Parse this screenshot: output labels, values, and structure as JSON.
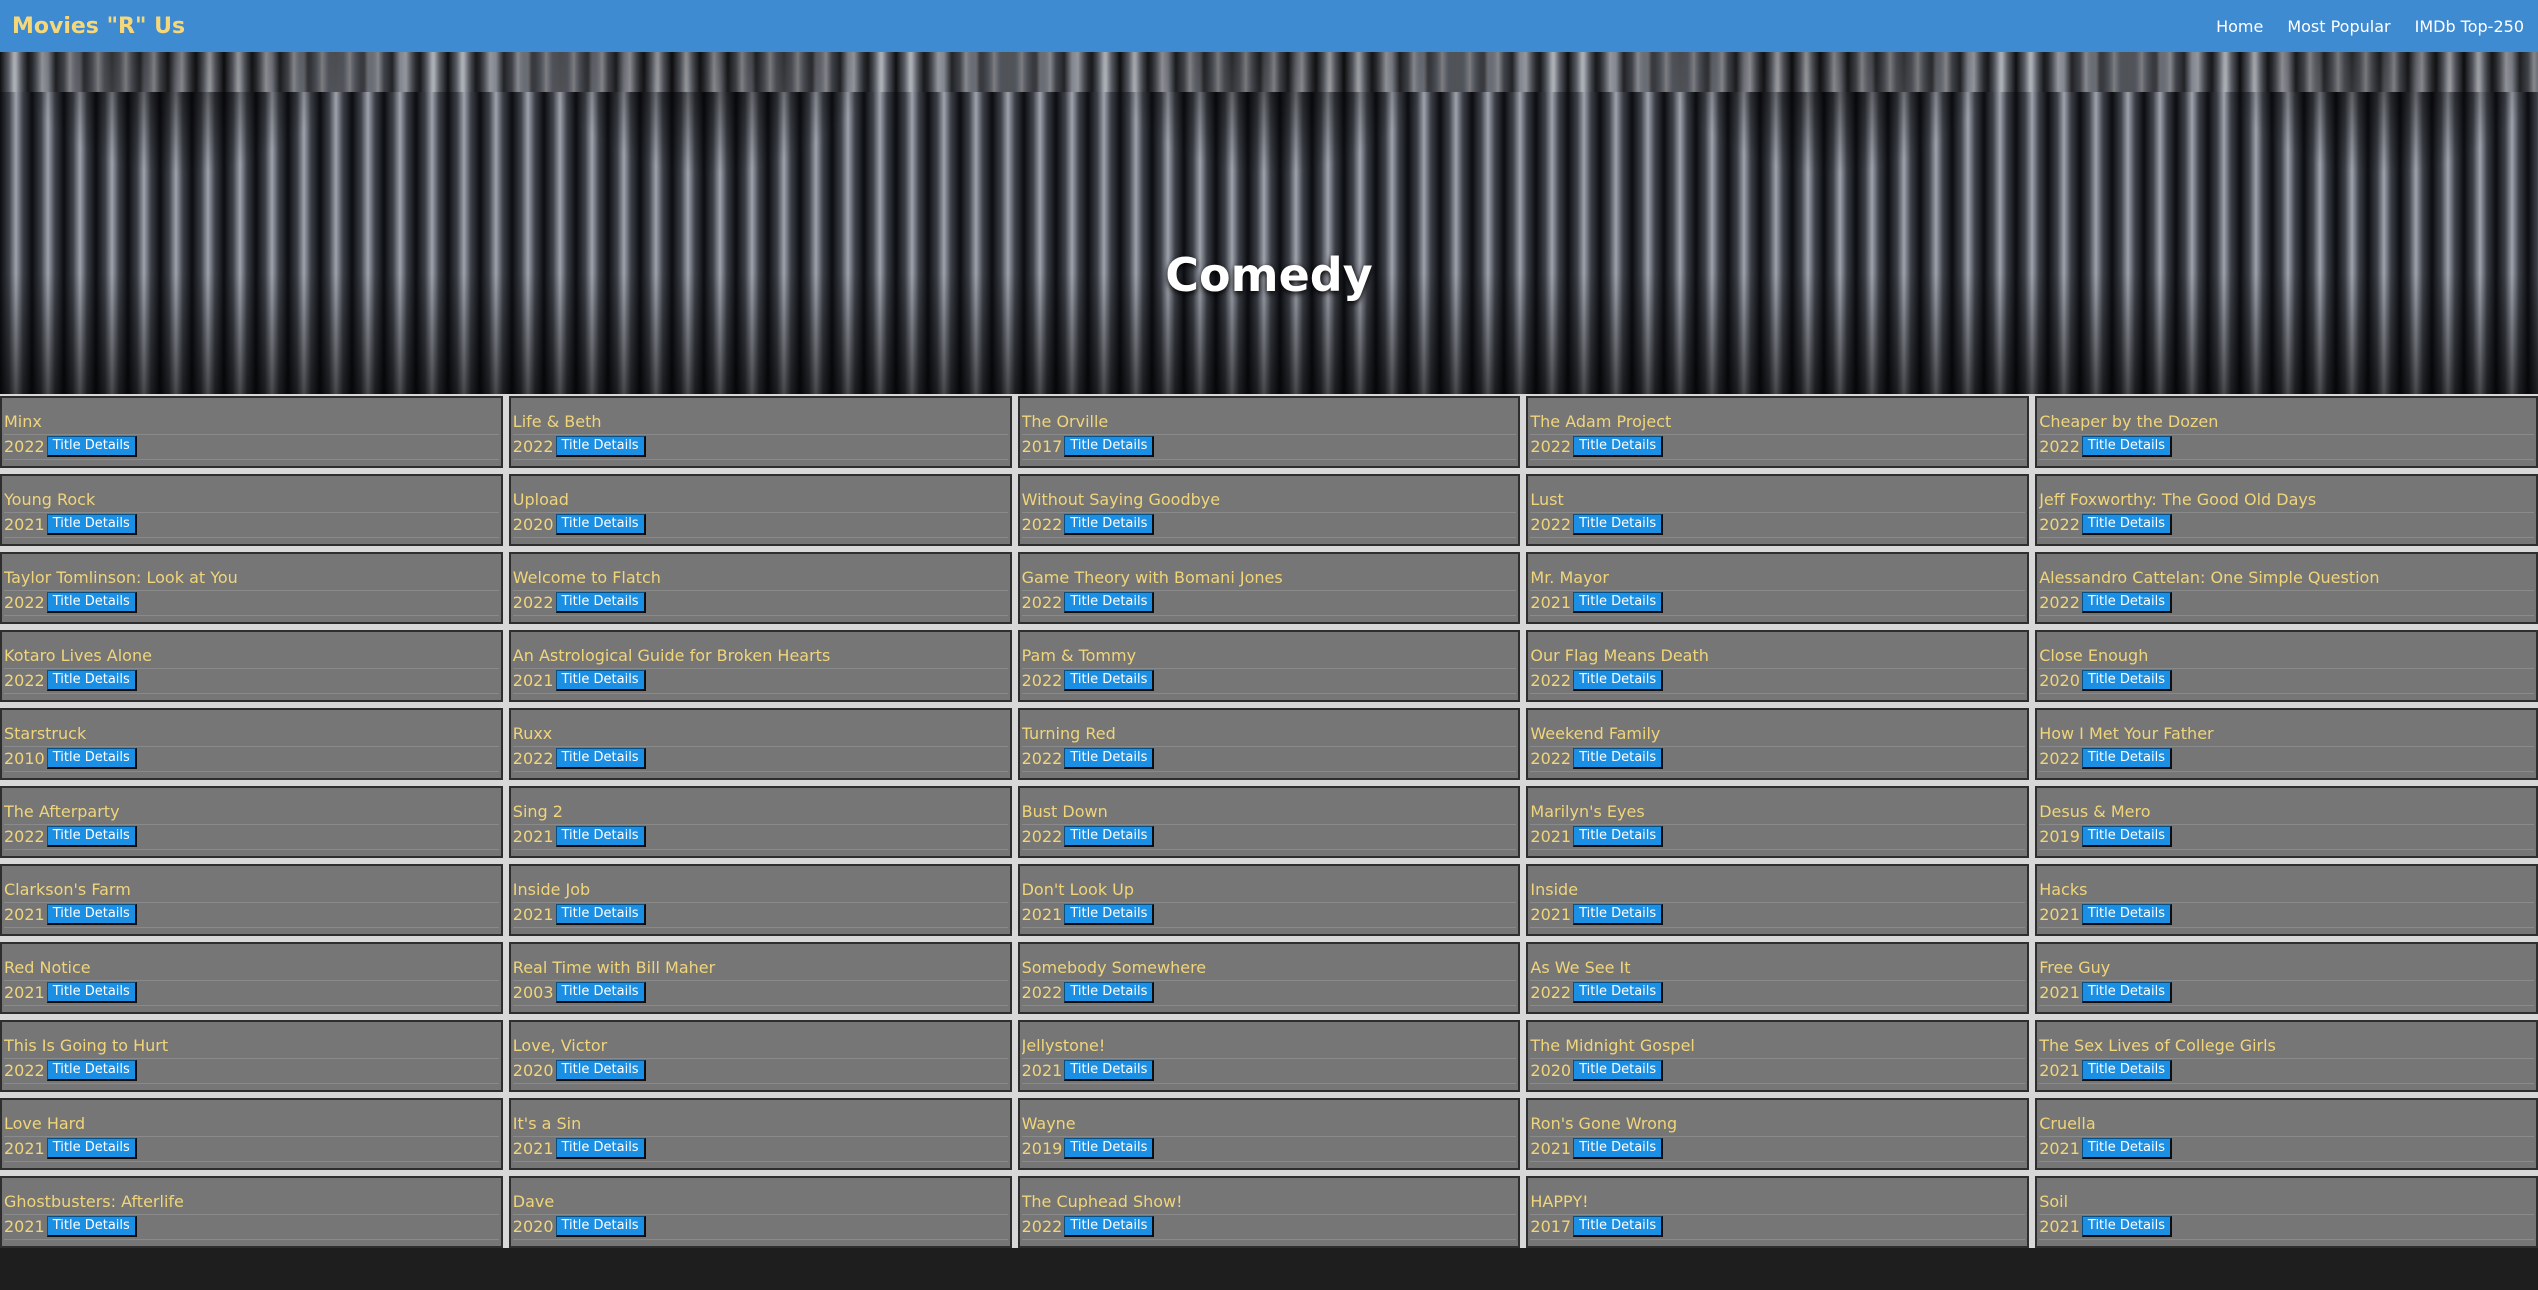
{
  "navbar": {
    "brand": "Movies \"R\" Us",
    "links": [
      "Home",
      "Most Popular",
      "IMDb Top-250"
    ]
  },
  "hero": {
    "title": "Comedy"
  },
  "button_label": "Title Details",
  "movies": [
    {
      "title": "Minx",
      "year": "2022"
    },
    {
      "title": "Life & Beth",
      "year": "2022"
    },
    {
      "title": "The Orville",
      "year": "2017"
    },
    {
      "title": "The Adam Project",
      "year": "2022"
    },
    {
      "title": "Cheaper by the Dozen",
      "year": "2022"
    },
    {
      "title": "Young Rock",
      "year": "2021"
    },
    {
      "title": "Upload",
      "year": "2020"
    },
    {
      "title": "Without Saying Goodbye",
      "year": "2022"
    },
    {
      "title": "Lust",
      "year": "2022"
    },
    {
      "title": "Jeff Foxworthy: The Good Old Days",
      "year": "2022"
    },
    {
      "title": "Taylor Tomlinson: Look at You",
      "year": "2022"
    },
    {
      "title": "Welcome to Flatch",
      "year": "2022"
    },
    {
      "title": "Game Theory with Bomani Jones",
      "year": "2022"
    },
    {
      "title": "Mr. Mayor",
      "year": "2021"
    },
    {
      "title": "Alessandro Cattelan: One Simple Question",
      "year": "2022"
    },
    {
      "title": "Kotaro Lives Alone",
      "year": "2022"
    },
    {
      "title": "An Astrological Guide for Broken Hearts",
      "year": "2021"
    },
    {
      "title": "Pam & Tommy",
      "year": "2022"
    },
    {
      "title": "Our Flag Means Death",
      "year": "2022"
    },
    {
      "title": "Close Enough",
      "year": "2020"
    },
    {
      "title": "Starstruck",
      "year": "2010"
    },
    {
      "title": "Ruxx",
      "year": "2022"
    },
    {
      "title": "Turning Red",
      "year": "2022"
    },
    {
      "title": "Weekend Family",
      "year": "2022"
    },
    {
      "title": "How I Met Your Father",
      "year": "2022"
    },
    {
      "title": "The Afterparty",
      "year": "2022"
    },
    {
      "title": "Sing 2",
      "year": "2021"
    },
    {
      "title": "Bust Down",
      "year": "2022"
    },
    {
      "title": "Marilyn's Eyes",
      "year": "2021"
    },
    {
      "title": "Desus & Mero",
      "year": "2019"
    },
    {
      "title": "Clarkson's Farm",
      "year": "2021"
    },
    {
      "title": "Inside Job",
      "year": "2021"
    },
    {
      "title": "Don't Look Up",
      "year": "2021"
    },
    {
      "title": "Inside",
      "year": "2021"
    },
    {
      "title": "Hacks",
      "year": "2021"
    },
    {
      "title": "Red Notice",
      "year": "2021"
    },
    {
      "title": "Real Time with Bill Maher",
      "year": "2003"
    },
    {
      "title": "Somebody Somewhere",
      "year": "2022"
    },
    {
      "title": "As We See It",
      "year": "2022"
    },
    {
      "title": "Free Guy",
      "year": "2021"
    },
    {
      "title": "This Is Going to Hurt",
      "year": "2022"
    },
    {
      "title": "Love, Victor",
      "year": "2020"
    },
    {
      "title": "Jellystone!",
      "year": "2021"
    },
    {
      "title": "The Midnight Gospel",
      "year": "2020"
    },
    {
      "title": "The Sex Lives of College Girls",
      "year": "2021"
    },
    {
      "title": "Love Hard",
      "year": "2021"
    },
    {
      "title": "It's a Sin",
      "year": "2021"
    },
    {
      "title": "Wayne",
      "year": "2019"
    },
    {
      "title": "Ron's Gone Wrong",
      "year": "2021"
    },
    {
      "title": "Cruella",
      "year": "2021"
    },
    {
      "title": "Ghostbusters: Afterlife",
      "year": "2021"
    },
    {
      "title": "Dave",
      "year": "2020"
    },
    {
      "title": "The Cuphead Show!",
      "year": "2022"
    },
    {
      "title": "HAPPY!",
      "year": "2017"
    },
    {
      "title": "Soil",
      "year": "2021"
    }
  ]
}
